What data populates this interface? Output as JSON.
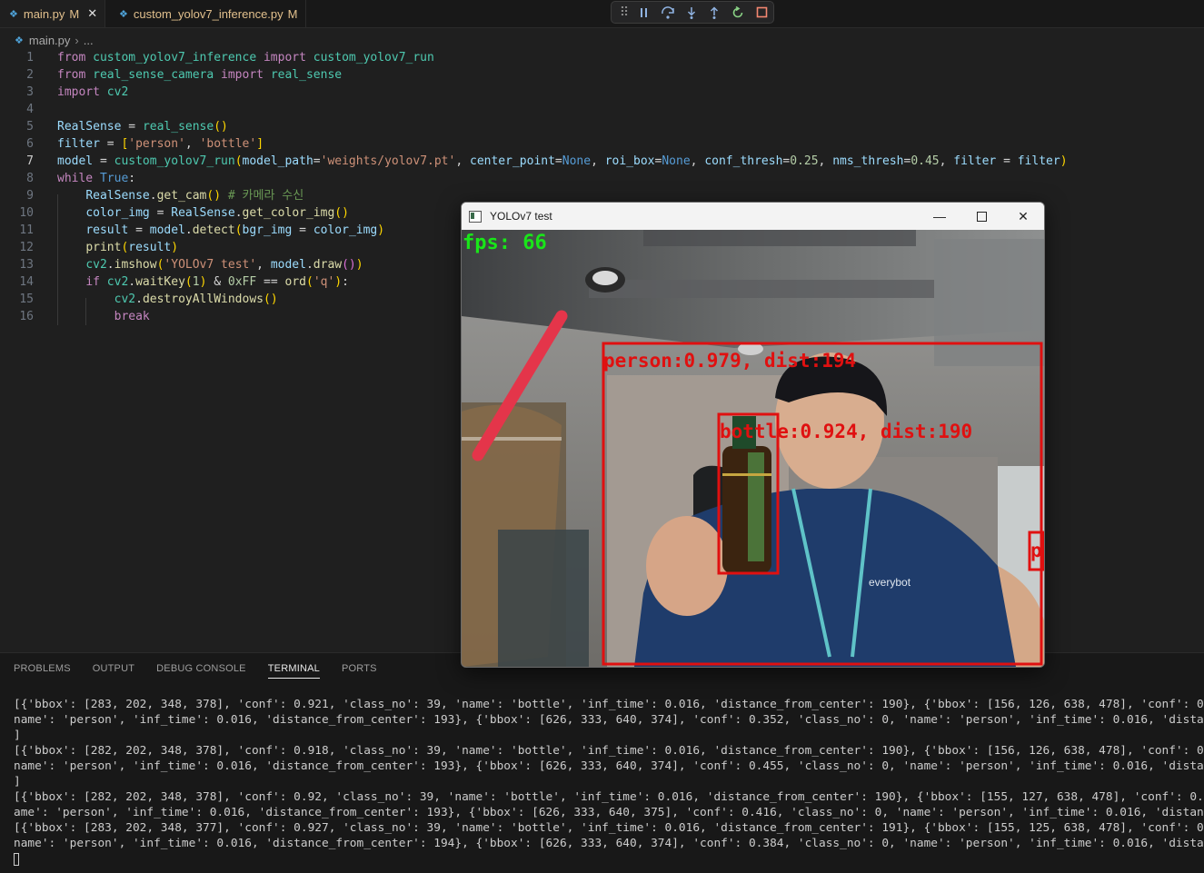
{
  "tabs": [
    {
      "name": "main.py",
      "status": "M",
      "active": true
    },
    {
      "name": "custom_yolov7_inference.py",
      "status": "M",
      "active": false
    }
  ],
  "breadcrumb": {
    "file": "main.py",
    "rest": "..."
  },
  "code": {
    "current_line": 7,
    "line_numbers": [
      "1",
      "2",
      "3",
      "4",
      "5",
      "6",
      "7",
      "8",
      "9",
      "10",
      "11",
      "12",
      "13",
      "14",
      "15",
      "16"
    ],
    "line9_comment": "# 카메라 수신"
  },
  "panel": {
    "tabs": [
      "PROBLEMS",
      "OUTPUT",
      "DEBUG CONSOLE",
      "TERMINAL",
      "PORTS"
    ],
    "active_tab": "TERMINAL",
    "terminal_lines": [
      "[{'bbox': [283, 202, 348, 378], 'conf': 0.921, 'class_no': 39, 'name': 'bottle', 'inf_time': 0.016, 'distance_from_center': 190}, {'bbox': [156, 126, 638, 478], 'conf': 0.978, 'class_no': 0, '",
      "name': 'person', 'inf_time': 0.016, 'distance_from_center': 193}, {'bbox': [626, 333, 640, 374], 'conf': 0.352, 'class_no': 0, 'name': 'person', 'inf_time': 0.016, 'distance_from_center': 0",
      "]",
      "[{'bbox': [282, 202, 348, 378], 'conf': 0.918, 'class_no': 39, 'name': 'bottle', 'inf_time': 0.016, 'distance_from_center': 190}, {'bbox': [156, 126, 638, 478], 'conf': 0.979, 'class_no': 0, '",
      "name': 'person', 'inf_time': 0.016, 'distance_from_center': 193}, {'bbox': [626, 333, 640, 374], 'conf': 0.455, 'class_no': 0, 'name': 'person', 'inf_time': 0.016, 'distance_from_center': 0",
      "]",
      "[{'bbox': [282, 202, 348, 378], 'conf': 0.92, 'class_no': 39, 'name': 'bottle', 'inf_time': 0.016, 'distance_from_center': 190}, {'bbox': [155, 127, 638, 478], 'conf': 0.979, 'class_no': 0, 'n",
      "ame': 'person', 'inf_time': 0.016, 'distance_from_center': 193}, {'bbox': [626, 333, 640, 375], 'conf': 0.416, 'class_no': 0, 'name': 'person', 'inf_time': 0.016, 'distance_from_center': 0}]",
      "[{'bbox': [283, 202, 348, 377], 'conf': 0.927, 'class_no': 39, 'name': 'bottle', 'inf_time': 0.016, 'distance_from_center': 191}, {'bbox': [155, 125, 638, 478], 'conf': 0.978, 'class_no': 0, '",
      "name': 'person', 'inf_time': 0.016, 'distance_from_center': 194}, {'bbox': [626, 333, 640, 374], 'conf': 0.384, 'class_no': 0, 'name': 'person', 'inf_time': 0.016, 'distance_from_center': 0"
    ]
  },
  "cv_window": {
    "title": "YOLOv7 test",
    "fps_label": "fps: 66",
    "detections": [
      {
        "label": "person:0.979, dist:194"
      },
      {
        "label": "bottle:0.924, dist:190"
      },
      {
        "label": "p"
      }
    ]
  },
  "colors": {
    "editor_bg": "#1f1f1f",
    "detection_box": "#e01010",
    "fps_text": "#19e619",
    "modified": "#e2c08d"
  },
  "icons": {
    "debug_toolbar": [
      "gripper-icon",
      "pause-icon",
      "step-over-icon",
      "step-into-icon",
      "step-out-icon",
      "restart-icon",
      "stop-icon"
    ],
    "window_controls": [
      "minimize-icon",
      "maximize-icon",
      "close-icon"
    ]
  }
}
